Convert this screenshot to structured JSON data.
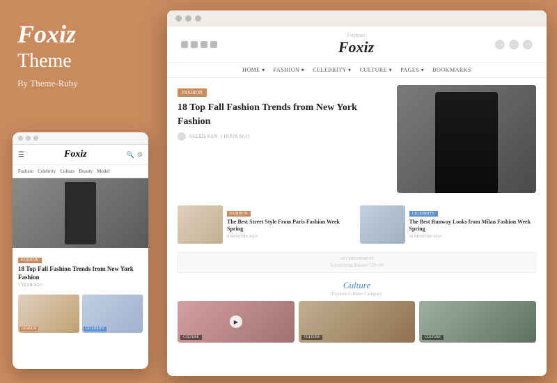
{
  "left": {
    "brand": "Foxiz",
    "theme_label": "Theme",
    "by_label": "By Theme-Ruby"
  },
  "mobile": {
    "logo": "Foxiz",
    "nav_items": [
      "Fashion",
      "Celebrity",
      "Culture",
      "Beauty",
      "Model"
    ],
    "fashion_badge": "FASHION",
    "article_title": "18 Top Fall Fashion Trends from New York Fashion",
    "meta": "1 YEAR AGO",
    "card1_badge": "FASHION",
    "card2_badge": "CELEBRITY"
  },
  "desktop": {
    "logo_script": "Fashion",
    "logo_main": "Foxiz",
    "nav_items": [
      "HOME ▾",
      "FASHION ▾",
      "CELEBRITY ▾",
      "CULTURE ▾",
      "PAGES ▾",
      "BOOKMARKS"
    ],
    "fashion_badge": "FASHION",
    "featured_title": "18 Top Fall Fashion Trends from New York Fashion",
    "featured_author": "ALEXIS RAN",
    "featured_time": "1 HOUR AGO",
    "sub1_badge": "FASHION",
    "sub1_title": "The Best Street Style From Paris Fashion Week Spring",
    "sub1_time": "8 MONTHS AGO",
    "sub2_badge": "CELEBRITY",
    "sub2_title": "The Best Runway Looks from Milan Fashion Week Spring",
    "sub2_time": "10 MONTHS AGO",
    "ad_label": "ADVERTISEMENT",
    "ad_text": "Advertising Banner 728×90",
    "culture_title": "Culture",
    "culture_subtitle": "Explore Culture Category"
  },
  "colors": {
    "bg": "#C98A5E",
    "badge_fashion": "#C98A5E",
    "badge_celebrity": "#5a8fd4",
    "culture_link": "#4a90d9"
  }
}
